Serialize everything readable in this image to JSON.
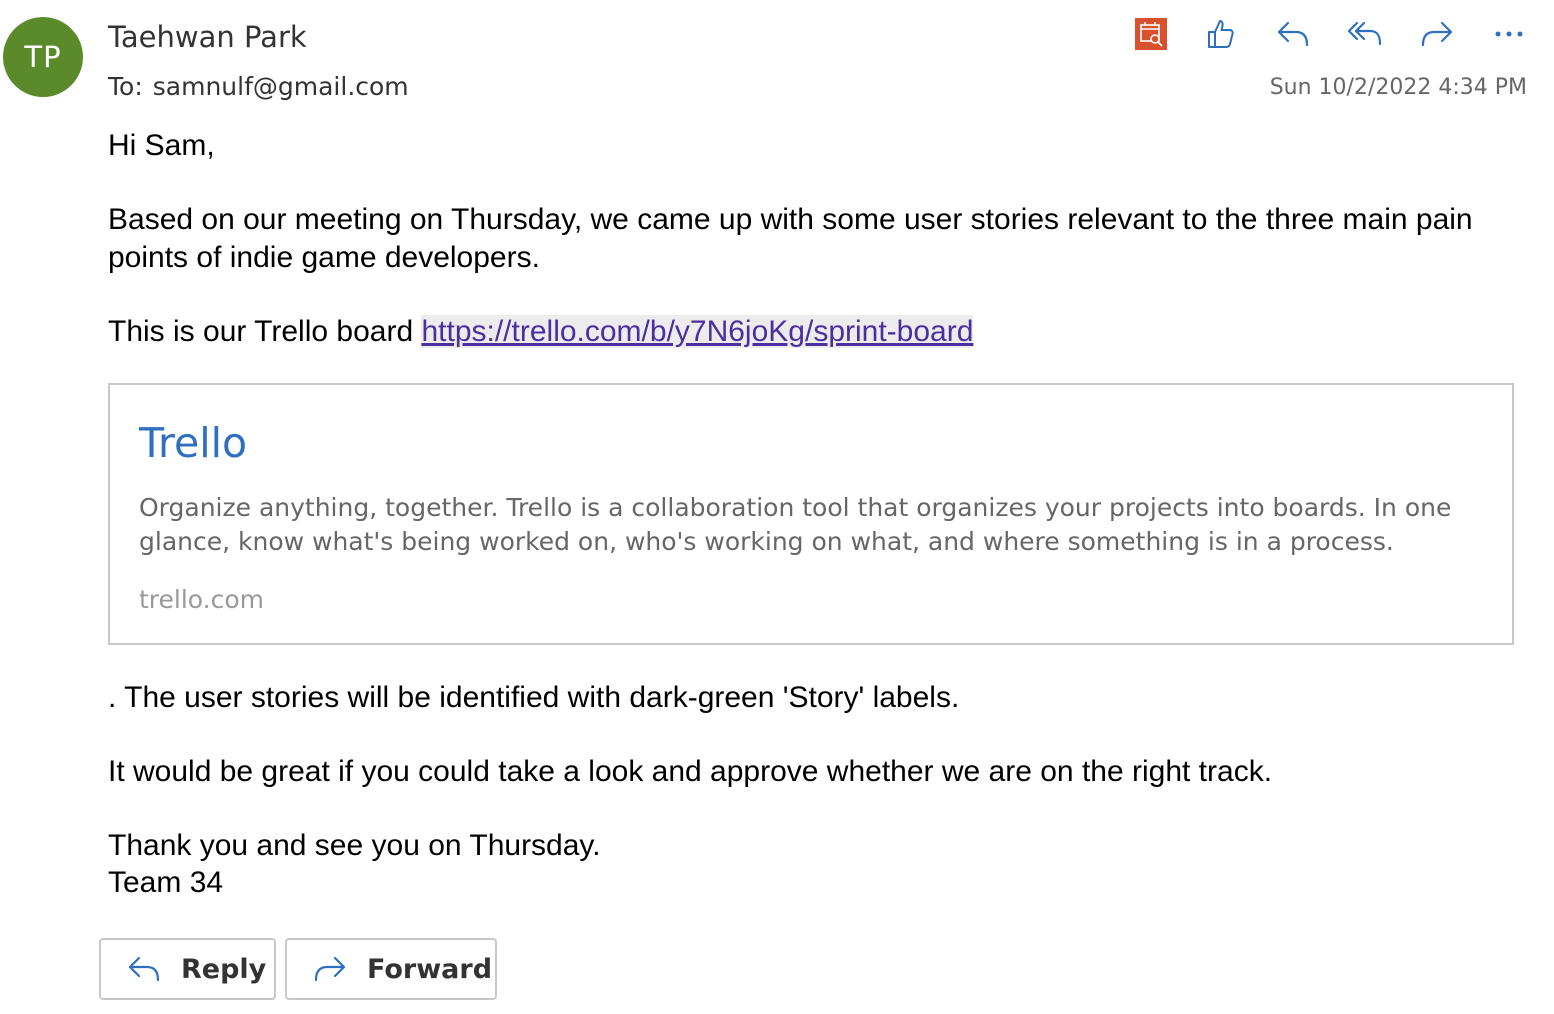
{
  "header": {
    "avatar_initials": "TP",
    "avatar_color": "#5b8a2a",
    "sender_name": "Taehwan Park",
    "to_label": "To:",
    "to_address": "samnulf@gmail.com",
    "timestamp": "Sun 10/2/2022 4:34 PM"
  },
  "toolbar": {
    "icons": [
      "calendar-search-icon",
      "like-icon",
      "reply-icon",
      "reply-all-icon",
      "forward-icon",
      "more-options-icon"
    ],
    "accent_color": "#2f6fbf",
    "calendar_icon_color": "#d9512c"
  },
  "body": {
    "greeting": "Hi Sam,",
    "paragraph1": "Based on our meeting on Thursday, we came up with some user stories relevant to the three main pain points of indie game developers.",
    "trello_prefix": "This is our Trello board ",
    "trello_link": "https://trello.com/b/y7N6joKg/sprint-board",
    "paragraph3": ". The user stories will be identified with dark-green 'Story' labels.",
    "paragraph4": "It would be great if you could take a look and approve whether we are on the right track.",
    "closing": "Thank you and see you on Thursday.",
    "signature": "Team 34"
  },
  "link_preview": {
    "title": "Trello",
    "description": "Organize anything, together. Trello is a collaboration tool that organizes your projects into boards. In one glance, know what's being worked on, who's working on what, and where something is in a process.",
    "domain": "trello.com"
  },
  "actions": {
    "reply_label": "Reply",
    "forward_label": "Forward"
  }
}
